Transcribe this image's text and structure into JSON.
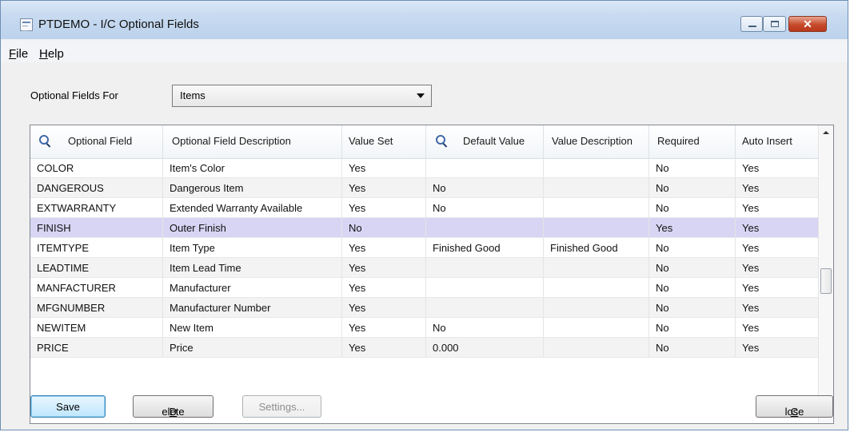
{
  "window": {
    "title": "PTDEMO - I/C Optional Fields"
  },
  "menu": [
    {
      "prefix": "",
      "mnemonic": "F",
      "rest": "ile"
    },
    {
      "prefix": "",
      "mnemonic": "H",
      "rest": "elp"
    }
  ],
  "filter": {
    "label": "Optional Fields For",
    "value": "Items"
  },
  "table": {
    "columns": [
      "Optional Field",
      "Optional Field Description",
      "Value Set",
      "Default Value",
      "Value Description",
      "Required",
      "Auto Insert"
    ],
    "rows": [
      [
        "COLOR",
        "Item's Color",
        "Yes",
        "",
        "",
        "No",
        "Yes"
      ],
      [
        "DANGEROUS",
        "Dangerous Item",
        "Yes",
        "No",
        "",
        "No",
        "Yes"
      ],
      [
        "EXTWARRANTY",
        "Extended Warranty Available",
        "Yes",
        "No",
        "",
        "No",
        "Yes"
      ],
      [
        "FINISH",
        "Outer Finish",
        "No",
        "",
        "",
        "Yes",
        "Yes"
      ],
      [
        "ITEMTYPE",
        "Item Type",
        "Yes",
        "Finished Good",
        "Finished Good",
        "No",
        "Yes"
      ],
      [
        "LEADTIME",
        "Item Lead Time",
        "Yes",
        "",
        "",
        "No",
        "Yes"
      ],
      [
        "MANFACTURER",
        "Manufacturer",
        "Yes",
        "",
        "",
        "No",
        "Yes"
      ],
      [
        "MFGNUMBER",
        "Manufacturer Number",
        "Yes",
        "",
        "",
        "No",
        "Yes"
      ],
      [
        "NEWITEM",
        "New Item",
        "Yes",
        "No",
        "",
        "No",
        "Yes"
      ],
      [
        "PRICE",
        "Price",
        "Yes",
        "0.000",
        "",
        "No",
        "Yes"
      ]
    ],
    "selected_row": 3
  },
  "buttons": {
    "save": {
      "label": "Save"
    },
    "delete": {
      "mnemonic": "D",
      "rest": "elete"
    },
    "settings": {
      "label": "Settings..."
    },
    "close": {
      "mnemonic": "C",
      "rest": "lose"
    }
  }
}
